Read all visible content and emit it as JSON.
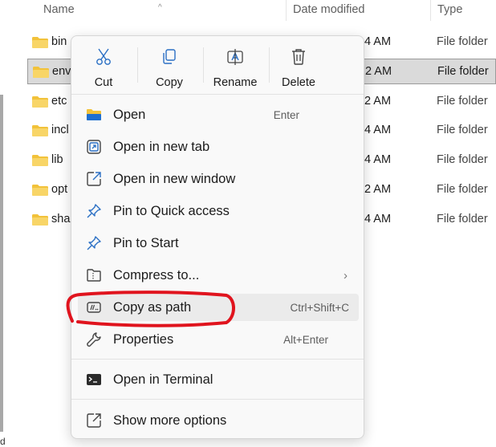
{
  "columns": {
    "name": "Name",
    "date_modified": "Date modified",
    "type": "Type"
  },
  "files": [
    {
      "name": "bin",
      "date": "4 AM",
      "type": "File folder",
      "selected": false
    },
    {
      "name": "env",
      "date": "2 AM",
      "type": "File folder",
      "selected": true
    },
    {
      "name": "etc",
      "date": "2 AM",
      "type": "File folder",
      "selected": false
    },
    {
      "name": "incl",
      "date": "4 AM",
      "type": "File folder",
      "selected": false
    },
    {
      "name": "lib",
      "date": "4 AM",
      "type": "File folder",
      "selected": false
    },
    {
      "name": "opt",
      "date": "2 AM",
      "type": "File folder",
      "selected": false
    },
    {
      "name": "sha",
      "date": "4 AM",
      "type": "File folder",
      "selected": false
    }
  ],
  "status_fragment": "d",
  "quick_actions": {
    "cut": "Cut",
    "copy": "Copy",
    "rename": "Rename",
    "delete": "Delete"
  },
  "menu_items": {
    "open": {
      "label": "Open",
      "shortcut": "Enter"
    },
    "open_new_tab": {
      "label": "Open in new tab"
    },
    "open_new_window": {
      "label": "Open in new window"
    },
    "pin_quick_access": {
      "label": "Pin to Quick access"
    },
    "pin_start": {
      "label": "Pin to Start"
    },
    "compress": {
      "label": "Compress to..."
    },
    "copy_as_path": {
      "label": "Copy as path",
      "shortcut": "Ctrl+Shift+C"
    },
    "properties": {
      "label": "Properties",
      "shortcut": "Alt+Enter"
    },
    "open_terminal": {
      "label": "Open in Terminal"
    },
    "show_more": {
      "label": "Show more options"
    }
  },
  "colors": {
    "accent": "#0067c0",
    "folder": "#f2c23a",
    "annotation": "#e0141e"
  }
}
